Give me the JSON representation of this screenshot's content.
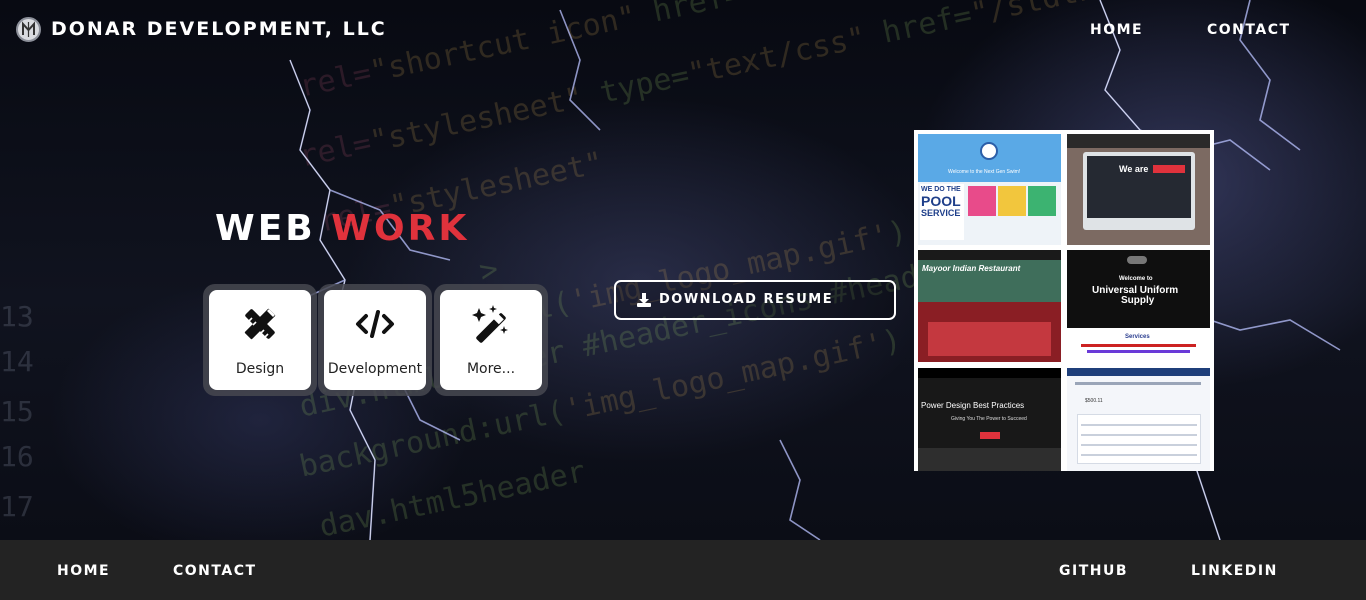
{
  "header": {
    "brand": "DONAR DEVELOPMENT, LLC",
    "nav": [
      "HOME",
      "CONTACT"
    ]
  },
  "hero": {
    "title_part1": "WEB",
    "title_part2": "WORK",
    "cards": [
      {
        "label": "Design",
        "icon": "design-tools-icon"
      },
      {
        "label": "Development",
        "icon": "code-icon"
      },
      {
        "label": "More...",
        "icon": "magic-wand-icon"
      }
    ],
    "download_label": "DOWNLOAD RESUME"
  },
  "portfolio": {
    "tile1_line1": "Welcome to the Next Gen Swim!",
    "tile1_line2": "WE DO THE",
    "tile1_line3": "POOL",
    "tile1_line4": "SERVICE",
    "tile2_text": "We are",
    "tile3_text": "Mayoor Indian Restaurant",
    "tile4_line1": "Welcome to",
    "tile4_line2": "Universal Uniform",
    "tile4_line3": "Supply",
    "tile4_line4": "Services",
    "tile5_line1": "Power Design Best Practices",
    "tile5_line2": "Giving You The Power to Succeed",
    "tile6_text": "$500.11"
  },
  "footer": {
    "left_nav": [
      "HOME",
      "CONTACT"
    ],
    "right_nav": [
      "GITHUB",
      "LINKEDIN"
    ]
  },
  "colors": {
    "accent_red": "#e0323c",
    "footer_bg": "#232323"
  }
}
